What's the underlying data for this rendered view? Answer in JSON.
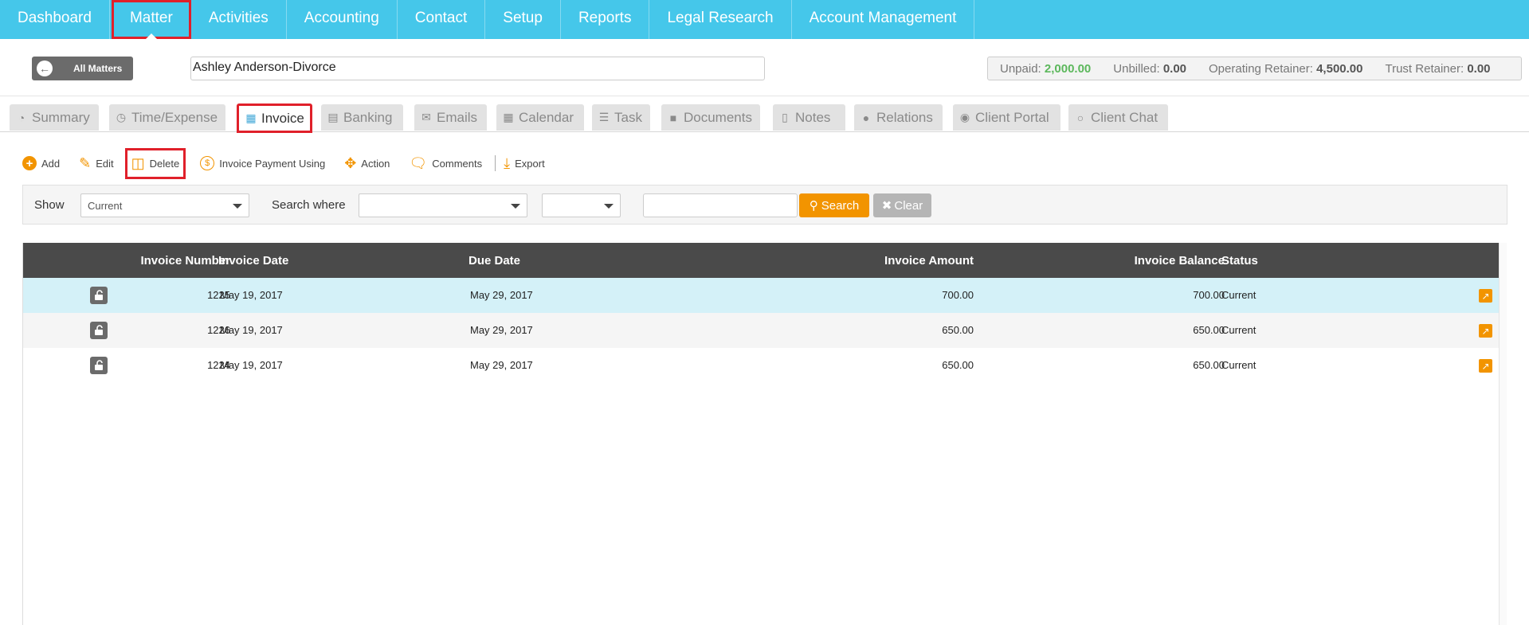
{
  "nav": {
    "items": [
      "Dashboard",
      "Matter",
      "Activities",
      "Accounting",
      "Contact",
      "Setup",
      "Reports",
      "Legal Research",
      "Account Management"
    ],
    "active": "Matter"
  },
  "matter": {
    "back_label": "All Matters",
    "name": "Ashley Anderson-Divorce",
    "balances": [
      {
        "label": "Unpaid:",
        "value": "2,000.00",
        "color": "#5cb85c"
      },
      {
        "label": "Unbilled:",
        "value": "0.00"
      },
      {
        "label": "Operating Retainer:",
        "value": "4,500.00"
      },
      {
        "label": "Trust Retainer:",
        "value": "0.00"
      }
    ]
  },
  "tabs": [
    {
      "label": "Summary",
      "icon": "dashboard-icon"
    },
    {
      "label": "Time/Expense",
      "icon": "clock-icon"
    },
    {
      "label": "Invoice",
      "icon": "calculator-icon"
    },
    {
      "label": "Banking",
      "icon": "bank-icon"
    },
    {
      "label": "Emails",
      "icon": "envelope-icon"
    },
    {
      "label": "Calendar",
      "icon": "calendar-icon"
    },
    {
      "label": "Task",
      "icon": "tasks-icon"
    },
    {
      "label": "Documents",
      "icon": "folder-icon"
    },
    {
      "label": "Notes",
      "icon": "note-icon"
    },
    {
      "label": "Relations",
      "icon": "users-icon"
    },
    {
      "label": "Client Portal",
      "icon": "portal-icon"
    },
    {
      "label": "Client Chat",
      "icon": "chat-icon"
    }
  ],
  "active_tab": "Invoice",
  "toolbar": {
    "add": "Add",
    "edit": "Edit",
    "delete": "Delete",
    "payment": "Invoice Payment Using",
    "action": "Action",
    "comments": "Comments",
    "export": "Export"
  },
  "filter": {
    "show_label": "Show",
    "show_value": "Current",
    "search_where_label": "Search where",
    "search_where_value": "",
    "operator_value": "",
    "search_text": "",
    "search_button": "Search",
    "clear_button": "Clear"
  },
  "table": {
    "columns": [
      "Invoice Number",
      "Invoice Date",
      "Due Date",
      "Invoice Amount",
      "Invoice Balance",
      "Status"
    ],
    "rows": [
      {
        "number": "1225",
        "date": "May 19, 2017",
        "due": "May 29, 2017",
        "amount": "700.00",
        "balance": "700.00",
        "status": "Current",
        "selected": true
      },
      {
        "number": "1226",
        "date": "May 19, 2017",
        "due": "May 29, 2017",
        "amount": "650.00",
        "balance": "650.00",
        "status": "Current",
        "selected": false
      },
      {
        "number": "1224",
        "date": "May 19, 2017",
        "due": "May 29, 2017",
        "amount": "650.00",
        "balance": "650.00",
        "status": "Current",
        "selected": false
      }
    ]
  },
  "colors": {
    "accent": "#45c7ea",
    "orange": "#f29400",
    "highlight": "#e0202a"
  }
}
